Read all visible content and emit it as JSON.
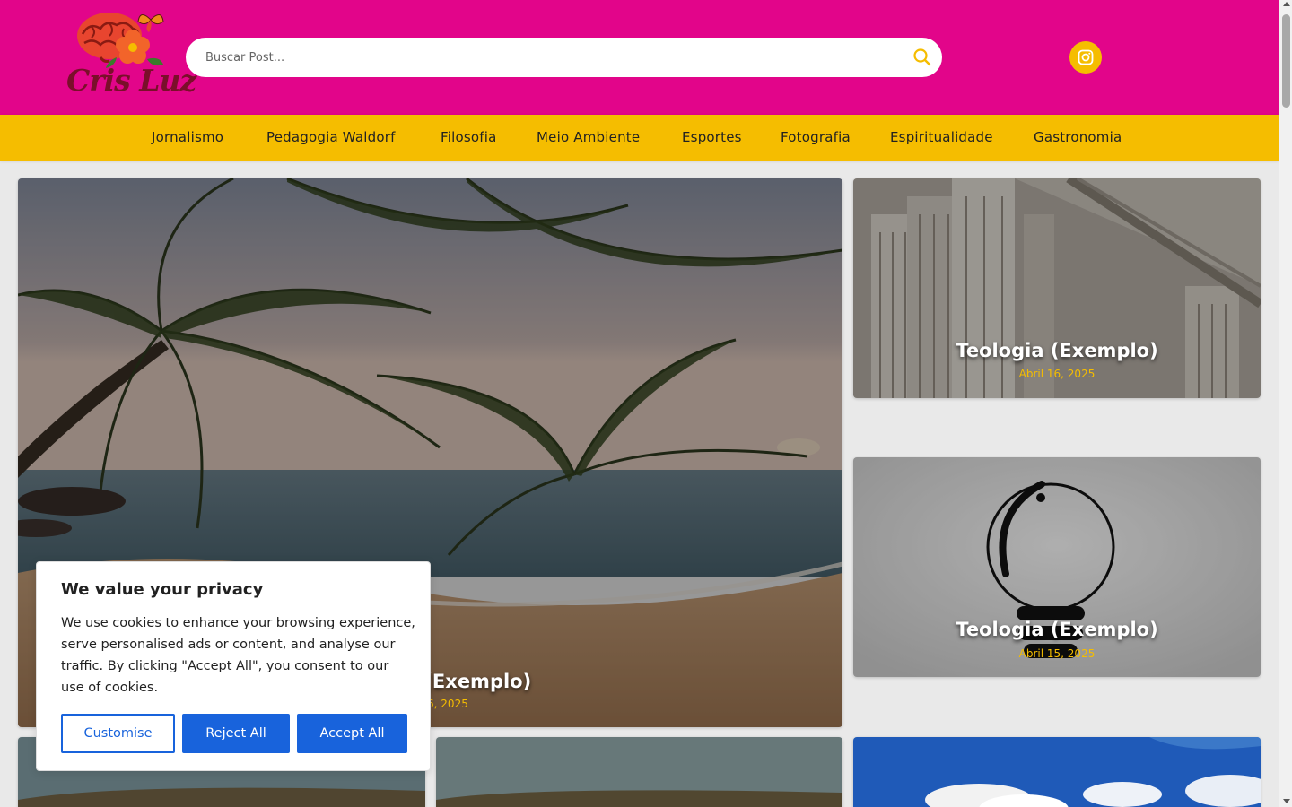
{
  "header": {
    "logo_text": "Cris Luz",
    "search_placeholder": "Buscar Post...",
    "search_icon": "search-icon",
    "social_icon": "instagram-icon"
  },
  "nav": {
    "items": [
      {
        "label": "Jornalismo"
      },
      {
        "label": "Pedagogia Waldorf"
      },
      {
        "label": "Filosofia"
      },
      {
        "label": "Meio Ambiente"
      },
      {
        "label": "Esportes"
      },
      {
        "label": "Fotografia"
      },
      {
        "label": "Espiritualidade"
      },
      {
        "label": "Gastronomia"
      }
    ]
  },
  "posts": {
    "featured": {
      "title": "Teologia (Exemplo)",
      "date": "Abril 16, 2025"
    },
    "side": [
      {
        "title": "Teologia (Exemplo)",
        "date": "Abril 16, 2025"
      },
      {
        "title": "Teologia (Exemplo)",
        "date": "Abril 15, 2025"
      }
    ]
  },
  "cookie": {
    "title": "We value your privacy",
    "text": "We use cookies to enhance your browsing experience, serve personalised ads or content, and analyse our traffic. By clicking \"Accept All\", you consent to our use of cookies.",
    "customise_label": "Customise",
    "reject_label": "Reject All",
    "accept_label": "Accept All"
  },
  "colors": {
    "header_bg": "#e2058a",
    "nav_bg": "#f5bd00",
    "accent": "#f5bd00",
    "button_blue": "#1863dc"
  }
}
